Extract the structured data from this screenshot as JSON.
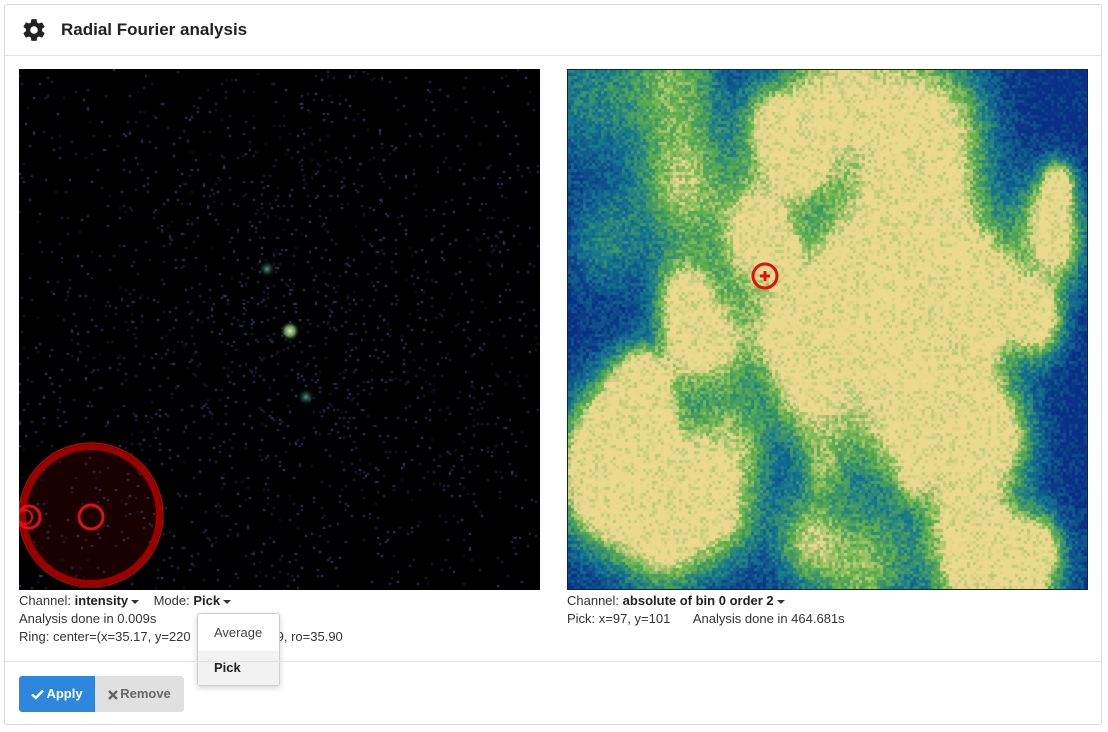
{
  "panel": {
    "title": "Radial Fourier analysis",
    "icon": "gear-icon"
  },
  "left": {
    "channel_label": "Channel:",
    "channel_value": "intensity",
    "mode_label": "Mode:",
    "mode_value": "Pick",
    "analysis_text": "Analysis done in 0.009s",
    "ring_text": "Ring: center=(x=35.17, y=220",
    "ring_text_tail": ", ro=35.90",
    "ring_text_hidden": "9"
  },
  "mode_dropdown": {
    "options": [
      "Average",
      "Pick"
    ],
    "selected": "Pick"
  },
  "right": {
    "channel_label": "Channel:",
    "channel_value": "absolute of bin 0 order 2",
    "pick_text": "Pick: x=97, y=101",
    "analysis_text": "Analysis done in 464.681s"
  },
  "footer": {
    "apply_label": "Apply",
    "remove_label": "Remove"
  },
  "colors": {
    "accent": "#2e86de",
    "ring": "#e01010",
    "map_low": "#0a2f86",
    "map_mid": "#5fae5a",
    "map_high": "#e8d890"
  }
}
